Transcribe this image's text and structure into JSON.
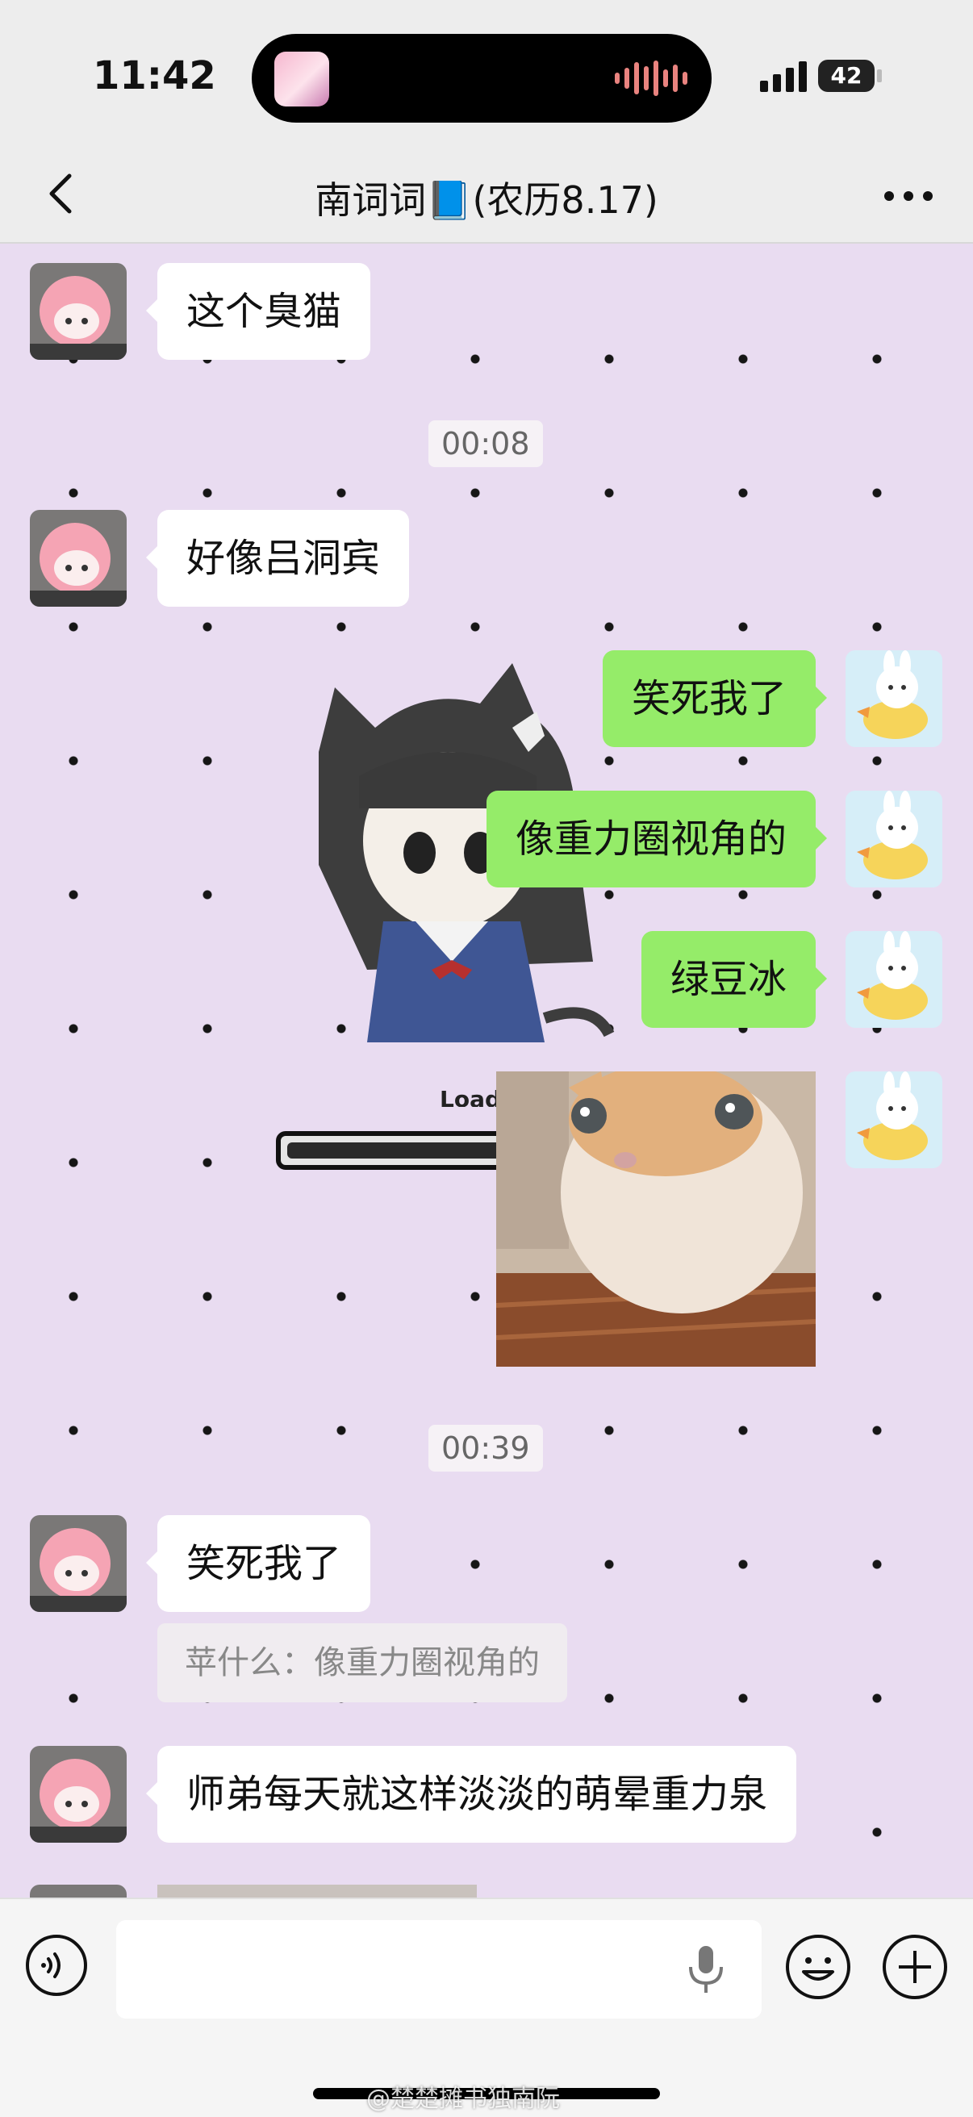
{
  "status_bar": {
    "time": "11:42",
    "battery": "42"
  },
  "nav": {
    "title": "南词词📘(农历8.17)"
  },
  "messages": [
    {
      "type": "text",
      "side": "left",
      "text": "这个臭猫"
    },
    {
      "type": "time",
      "text": "00:08"
    },
    {
      "type": "text",
      "side": "left",
      "text": "好像吕洞宾"
    },
    {
      "type": "text",
      "side": "right",
      "text": "笑死我了"
    },
    {
      "type": "text",
      "side": "right",
      "text": "像重力圈视角的"
    },
    {
      "type": "text",
      "side": "right",
      "text": "绿豆冰"
    },
    {
      "type": "image",
      "side": "right",
      "icon": "cat-photo",
      "sticker_text": "Loading"
    },
    {
      "type": "time",
      "text": "00:39"
    },
    {
      "type": "text",
      "side": "left",
      "text": "笑死我了"
    },
    {
      "type": "quote",
      "text": "苹什么：像重力圈视角的"
    },
    {
      "type": "text",
      "side": "left",
      "text": "师弟每天就这样淡淡的萌晕重力泉"
    }
  ],
  "input_bar": {
    "placeholder": ""
  },
  "watermark": "@楚楚摊书独南阮",
  "colors": {
    "chat_bg": "#e9dcf1",
    "out_bubble": "#95ec69",
    "in_bubble": "#ffffff",
    "bar_bg": "#ededed"
  }
}
